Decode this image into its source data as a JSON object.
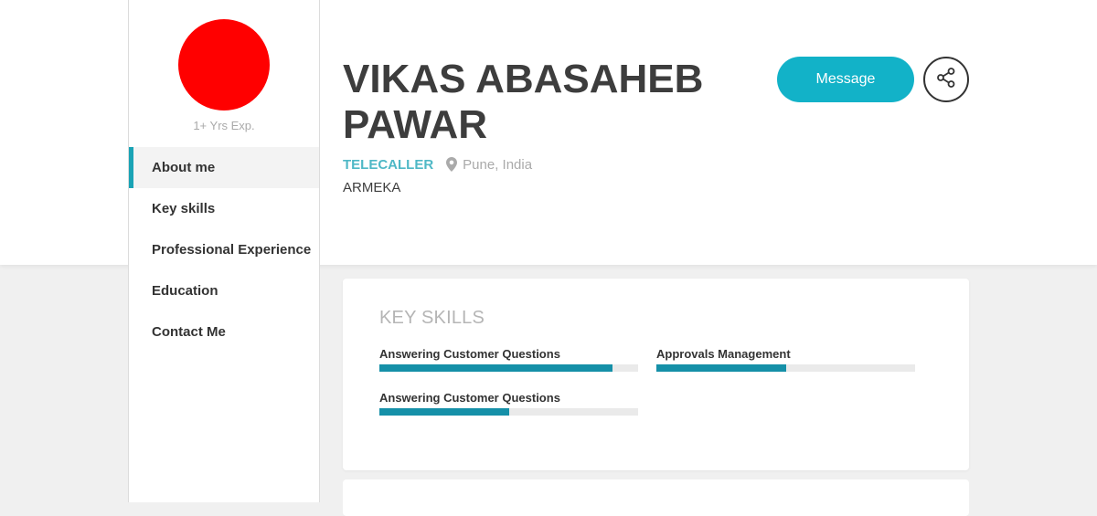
{
  "profile": {
    "name": "VIKAS ABASAHEB PAWAR",
    "role": "TELECALLER",
    "location": "Pune, India",
    "company": "ARMEKA",
    "experience": "1+ Yrs Exp.",
    "avatar_color": "#ff0000"
  },
  "actions": {
    "message_label": "Message",
    "share_icon": "share-icon"
  },
  "sidebar": {
    "items": [
      {
        "label": "About me",
        "active": true
      },
      {
        "label": "Key skills",
        "active": false
      },
      {
        "label": "Professional Experience",
        "active": false
      },
      {
        "label": "Education",
        "active": false
      },
      {
        "label": "Contact Me",
        "active": false
      }
    ]
  },
  "key_skills": {
    "title": "KEY SKILLS",
    "skills": [
      {
        "name": "Answering Customer Questions",
        "level": 0.9
      },
      {
        "name": "Approvals Management",
        "level": 0.5
      },
      {
        "name": "Answering Customer Questions",
        "level": 0.5
      }
    ]
  },
  "colors": {
    "accent": "#12b2c8",
    "role_text": "#4fb8c6",
    "skill_bar": "#1590a8",
    "active_border": "#1aa3b5"
  }
}
